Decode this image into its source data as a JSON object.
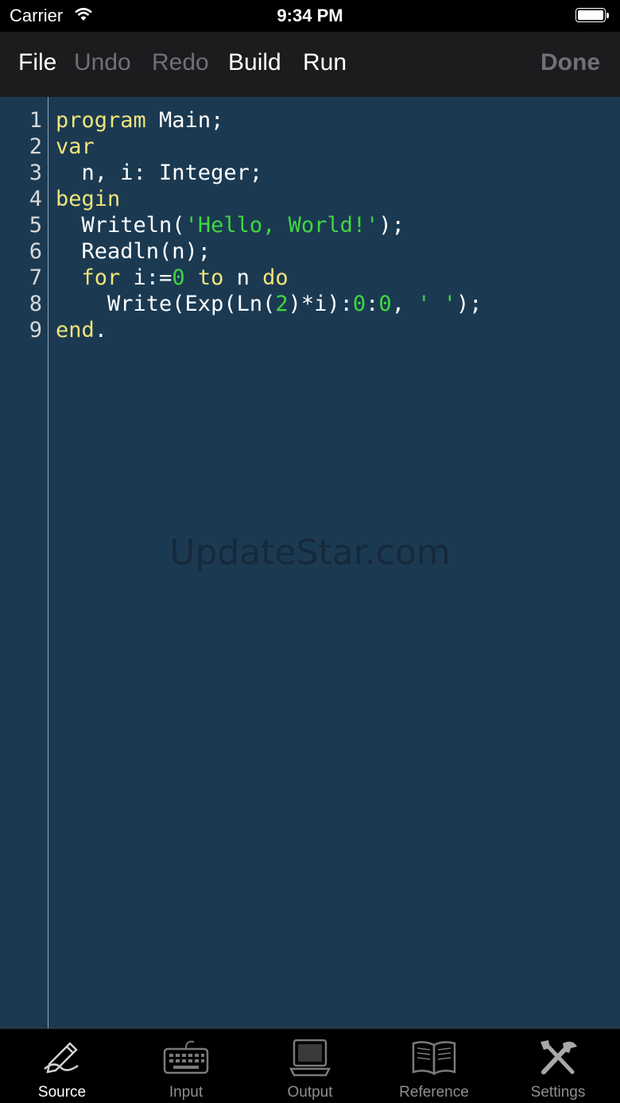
{
  "status": {
    "carrier": "Carrier",
    "time": "9:34 PM"
  },
  "toolbar": {
    "file": "File",
    "undo": "Undo",
    "redo": "Redo",
    "build": "Build",
    "run": "Run",
    "done": "Done"
  },
  "editor": {
    "line_numbers": [
      "1",
      "2",
      "3",
      "4",
      "5",
      "6",
      "7",
      "8",
      "9"
    ],
    "lines": [
      [
        {
          "t": "program",
          "c": "kw"
        },
        {
          "t": " Main;",
          "c": ""
        }
      ],
      [
        {
          "t": "var",
          "c": "kw"
        }
      ],
      [
        {
          "t": "  n, i: Integer;",
          "c": ""
        }
      ],
      [
        {
          "t": "begin",
          "c": "kw"
        }
      ],
      [
        {
          "t": "  Writeln(",
          "c": ""
        },
        {
          "t": "'Hello, World!'",
          "c": "str"
        },
        {
          "t": ");",
          "c": ""
        }
      ],
      [
        {
          "t": "  Readln(n);",
          "c": ""
        }
      ],
      [
        {
          "t": "  ",
          "c": ""
        },
        {
          "t": "for",
          "c": "kw"
        },
        {
          "t": " i:=",
          "c": ""
        },
        {
          "t": "0",
          "c": "num"
        },
        {
          "t": " ",
          "c": ""
        },
        {
          "t": "to",
          "c": "kw"
        },
        {
          "t": " n ",
          "c": ""
        },
        {
          "t": "do",
          "c": "kw"
        }
      ],
      [
        {
          "t": "    Write(Exp(Ln(",
          "c": ""
        },
        {
          "t": "2",
          "c": "num"
        },
        {
          "t": ")*i):",
          "c": ""
        },
        {
          "t": "0",
          "c": "num"
        },
        {
          "t": ":",
          "c": ""
        },
        {
          "t": "0",
          "c": "num"
        },
        {
          "t": ", ",
          "c": ""
        },
        {
          "t": "' '",
          "c": "str"
        },
        {
          "t": ");",
          "c": ""
        }
      ],
      [
        {
          "t": "end",
          "c": "kw"
        },
        {
          "t": ".",
          "c": ""
        }
      ]
    ],
    "watermark": "UpdateStar.com"
  },
  "tabs": [
    {
      "label": "Source",
      "icon": "pen-icon",
      "active": true
    },
    {
      "label": "Input",
      "icon": "keyboard-icon",
      "active": false
    },
    {
      "label": "Output",
      "icon": "monitor-icon",
      "active": false
    },
    {
      "label": "Reference",
      "icon": "book-icon",
      "active": false
    },
    {
      "label": "Settings",
      "icon": "tools-icon",
      "active": false
    }
  ],
  "colors": {
    "editor_bg": "#1b3a52",
    "keyword": "#f0e47a",
    "string": "#3fd83f",
    "disabled": "#6f7175"
  }
}
